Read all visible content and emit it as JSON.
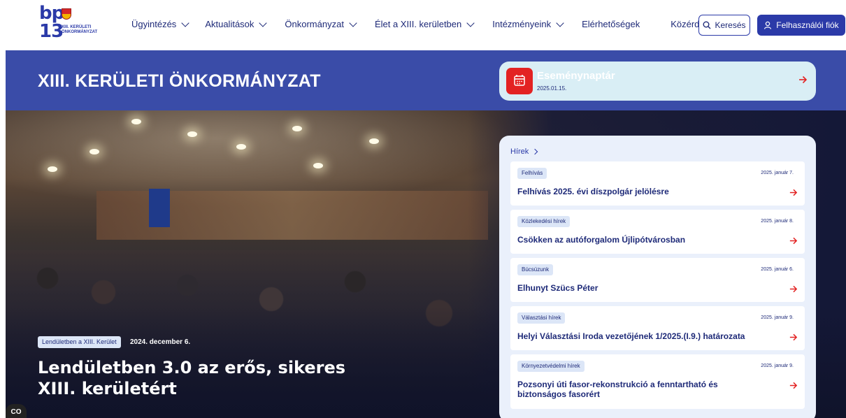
{
  "header": {
    "logo": {
      "top": "bp",
      "num": "13",
      "line1": "XIII. KERÜLETI",
      "line2": "ÖNKORMÁNYZAT"
    },
    "nav": [
      {
        "label": "Ügyintézés",
        "dropdown": true
      },
      {
        "label": "Aktualitások",
        "dropdown": true
      },
      {
        "label": "Önkormányzat",
        "dropdown": true
      },
      {
        "label": "Élet a XIII. kerületben",
        "dropdown": true
      },
      {
        "label": "Intézményeink",
        "dropdown": true
      },
      {
        "label": "Elérhetőségek",
        "dropdown": false
      },
      {
        "label": "Közérdekű adatok",
        "dropdown": false
      }
    ],
    "search_label": "Keresés",
    "account_label": "Felhasználói fiók"
  },
  "band": {
    "title": "XIII. KERÜLETI ÖNKORMÁNYZAT",
    "event": {
      "title": "Eseménynaptár",
      "date": "2025.01.15."
    }
  },
  "hero": {
    "tag": "Lendületben a XIII. Kerület",
    "date": "2024. december 6.",
    "headline": "Lendületben 3.0 az erős, sikeres XIII. kerületért",
    "cc_label": "CO"
  },
  "news": {
    "heading": "Hírek",
    "items": [
      {
        "category": "Felhívás",
        "date": "2025. január 7.",
        "title": "Felhívás 2025. évi díszpolgár jelölésre"
      },
      {
        "category": "Közlekedési hírek",
        "date": "2025. január 8.",
        "title": "Csökken az autóforgalom Újlipótvárosban"
      },
      {
        "category": "Búcsúzunk",
        "date": "2025. január 6.",
        "title": "Elhunyt Szücs Péter"
      },
      {
        "category": "Választási hírek",
        "date": "2025. január 9.",
        "title": "Helyi Választási Iroda vezetőjének 1/2025.(I.9.) határozata"
      },
      {
        "category": "Környezetvédelmi hírek",
        "date": "2025. január 9.",
        "title": "Pozsonyi úti fasor-rekonstrukció a fenntartható és biztonságos fasorért"
      }
    ]
  },
  "colors": {
    "brand_blue": "#2b3aa8",
    "band_blue": "#3a4ca8",
    "accent_red": "#e32222",
    "event_bg": "#d9eef5",
    "panel_bg": "#eaf0fb"
  },
  "icons": {
    "search": "search-icon",
    "account": "user-icon",
    "calendar": "calendar-icon",
    "arrow": "arrow-right-icon"
  }
}
